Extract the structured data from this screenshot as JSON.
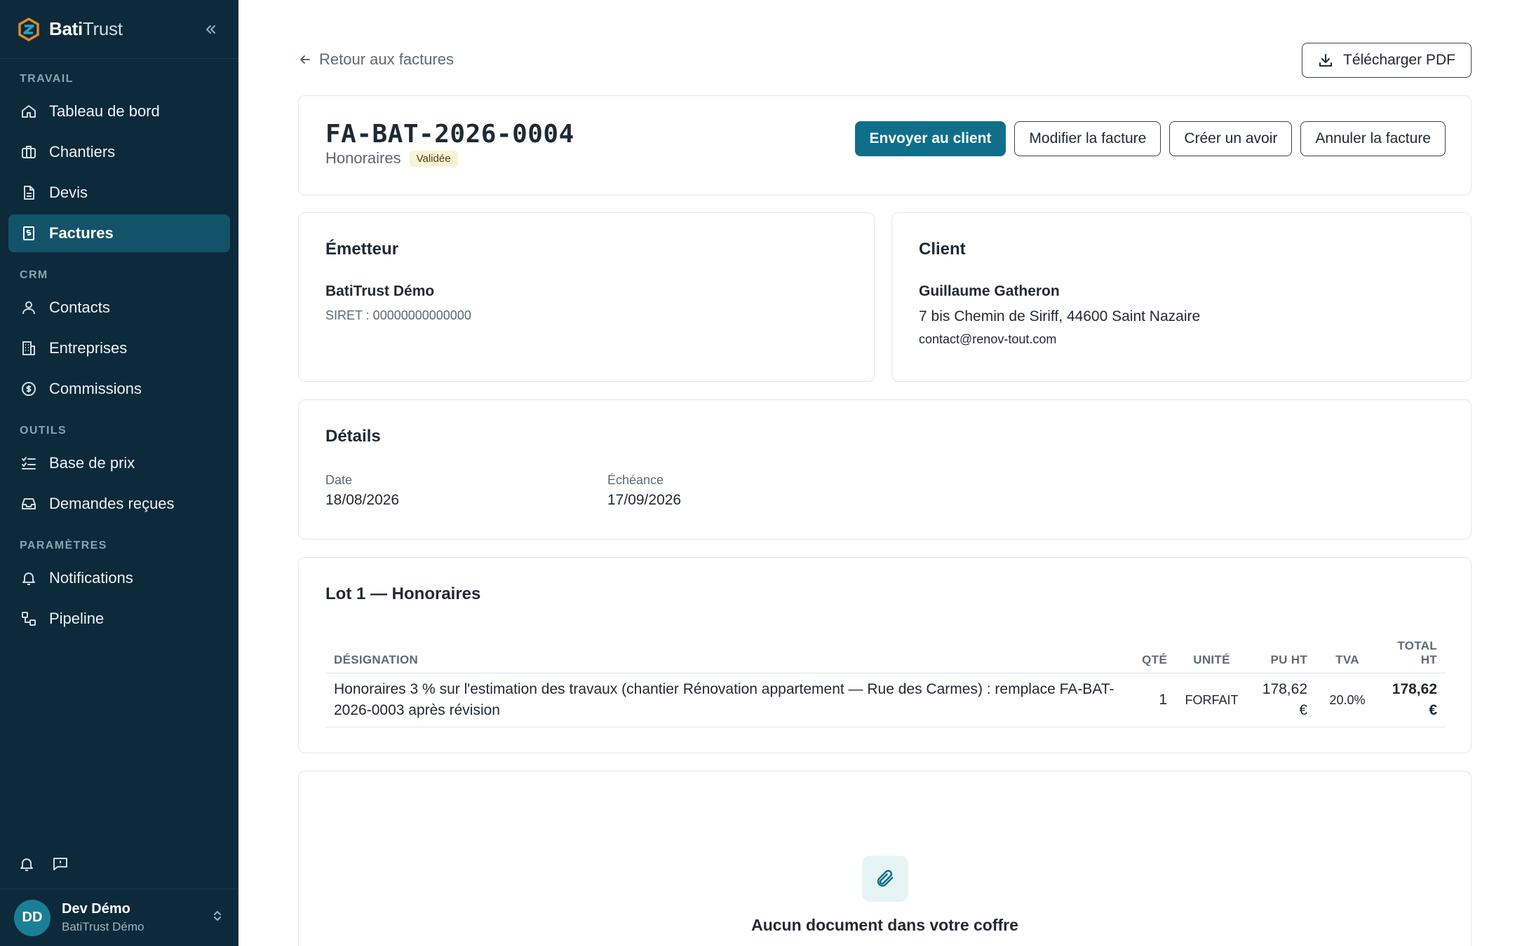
{
  "brand": {
    "name_bold": "Bati",
    "name_light": "Trust"
  },
  "sidebar": {
    "sections": [
      {
        "label": "TRAVAIL",
        "items": [
          {
            "label": "Tableau de bord",
            "icon": "home-icon"
          },
          {
            "label": "Chantiers",
            "icon": "briefcase-icon"
          },
          {
            "label": "Devis",
            "icon": "document-icon"
          },
          {
            "label": "Factures",
            "icon": "invoice-icon",
            "active": true
          }
        ]
      },
      {
        "label": "CRM",
        "items": [
          {
            "label": "Contacts",
            "icon": "user-icon"
          },
          {
            "label": "Entreprises",
            "icon": "building-icon"
          },
          {
            "label": "Commissions",
            "icon": "dollar-circle-icon"
          }
        ]
      },
      {
        "label": "OUTILS",
        "items": [
          {
            "label": "Base de prix",
            "icon": "list-check-icon"
          },
          {
            "label": "Demandes reçues",
            "icon": "inbox-icon"
          }
        ]
      },
      {
        "label": "PARAMÈTRES",
        "items": [
          {
            "label": "Notifications",
            "icon": "bell-icon"
          },
          {
            "label": "Pipeline",
            "icon": "workflow-icon"
          }
        ]
      }
    ],
    "user": {
      "initials": "DD",
      "name": "Dev Démo",
      "org": "BatiTrust Démo"
    }
  },
  "topbar": {
    "back_label": "Retour aux factures",
    "download_label": "Télécharger PDF"
  },
  "invoice": {
    "number": "FA-BAT-2026-0004",
    "type": "Honoraires",
    "status": "Validée",
    "actions": {
      "send": "Envoyer au client",
      "edit": "Modifier la facture",
      "credit": "Créer un avoir",
      "cancel": "Annuler la facture"
    }
  },
  "emitter": {
    "title": "Émetteur",
    "name": "BatiTrust Démo",
    "siret": "SIRET : 00000000000000"
  },
  "client": {
    "title": "Client",
    "name": "Guillaume Gatheron",
    "address": "7 bis Chemin de Siriff, 44600 Saint Nazaire",
    "email": "contact@renov-tout.com"
  },
  "details": {
    "title": "Détails",
    "date_label": "Date",
    "date_value": "18/08/2026",
    "due_label": "Échéance",
    "due_value": "17/09/2026"
  },
  "lot": {
    "title": "Lot 1 — Honoraires",
    "columns": {
      "designation": "DÉSIGNATION",
      "qty": "QTÉ",
      "unit": "UNITÉ",
      "pu": "PU HT",
      "tva": "TVA",
      "total": "TOTAL HT"
    },
    "lines": [
      {
        "designation": "Honoraires 3 % sur l'estimation des travaux (chantier Rénovation appartement — Rue des Carmes) : remplace FA-BAT-2026-0003 après révision",
        "qty": "1",
        "unit": "FORFAIT",
        "pu": "178,62 €",
        "tva": "20.0%",
        "total": "178,62 €"
      }
    ]
  },
  "documents": {
    "empty_title": "Aucun document dans votre coffre"
  },
  "colors": {
    "sidebar_bg": "#0d2a3a",
    "active_item": "#13536a",
    "primary": "#0f6f8a",
    "badge_bg": "#fbf3d7"
  }
}
